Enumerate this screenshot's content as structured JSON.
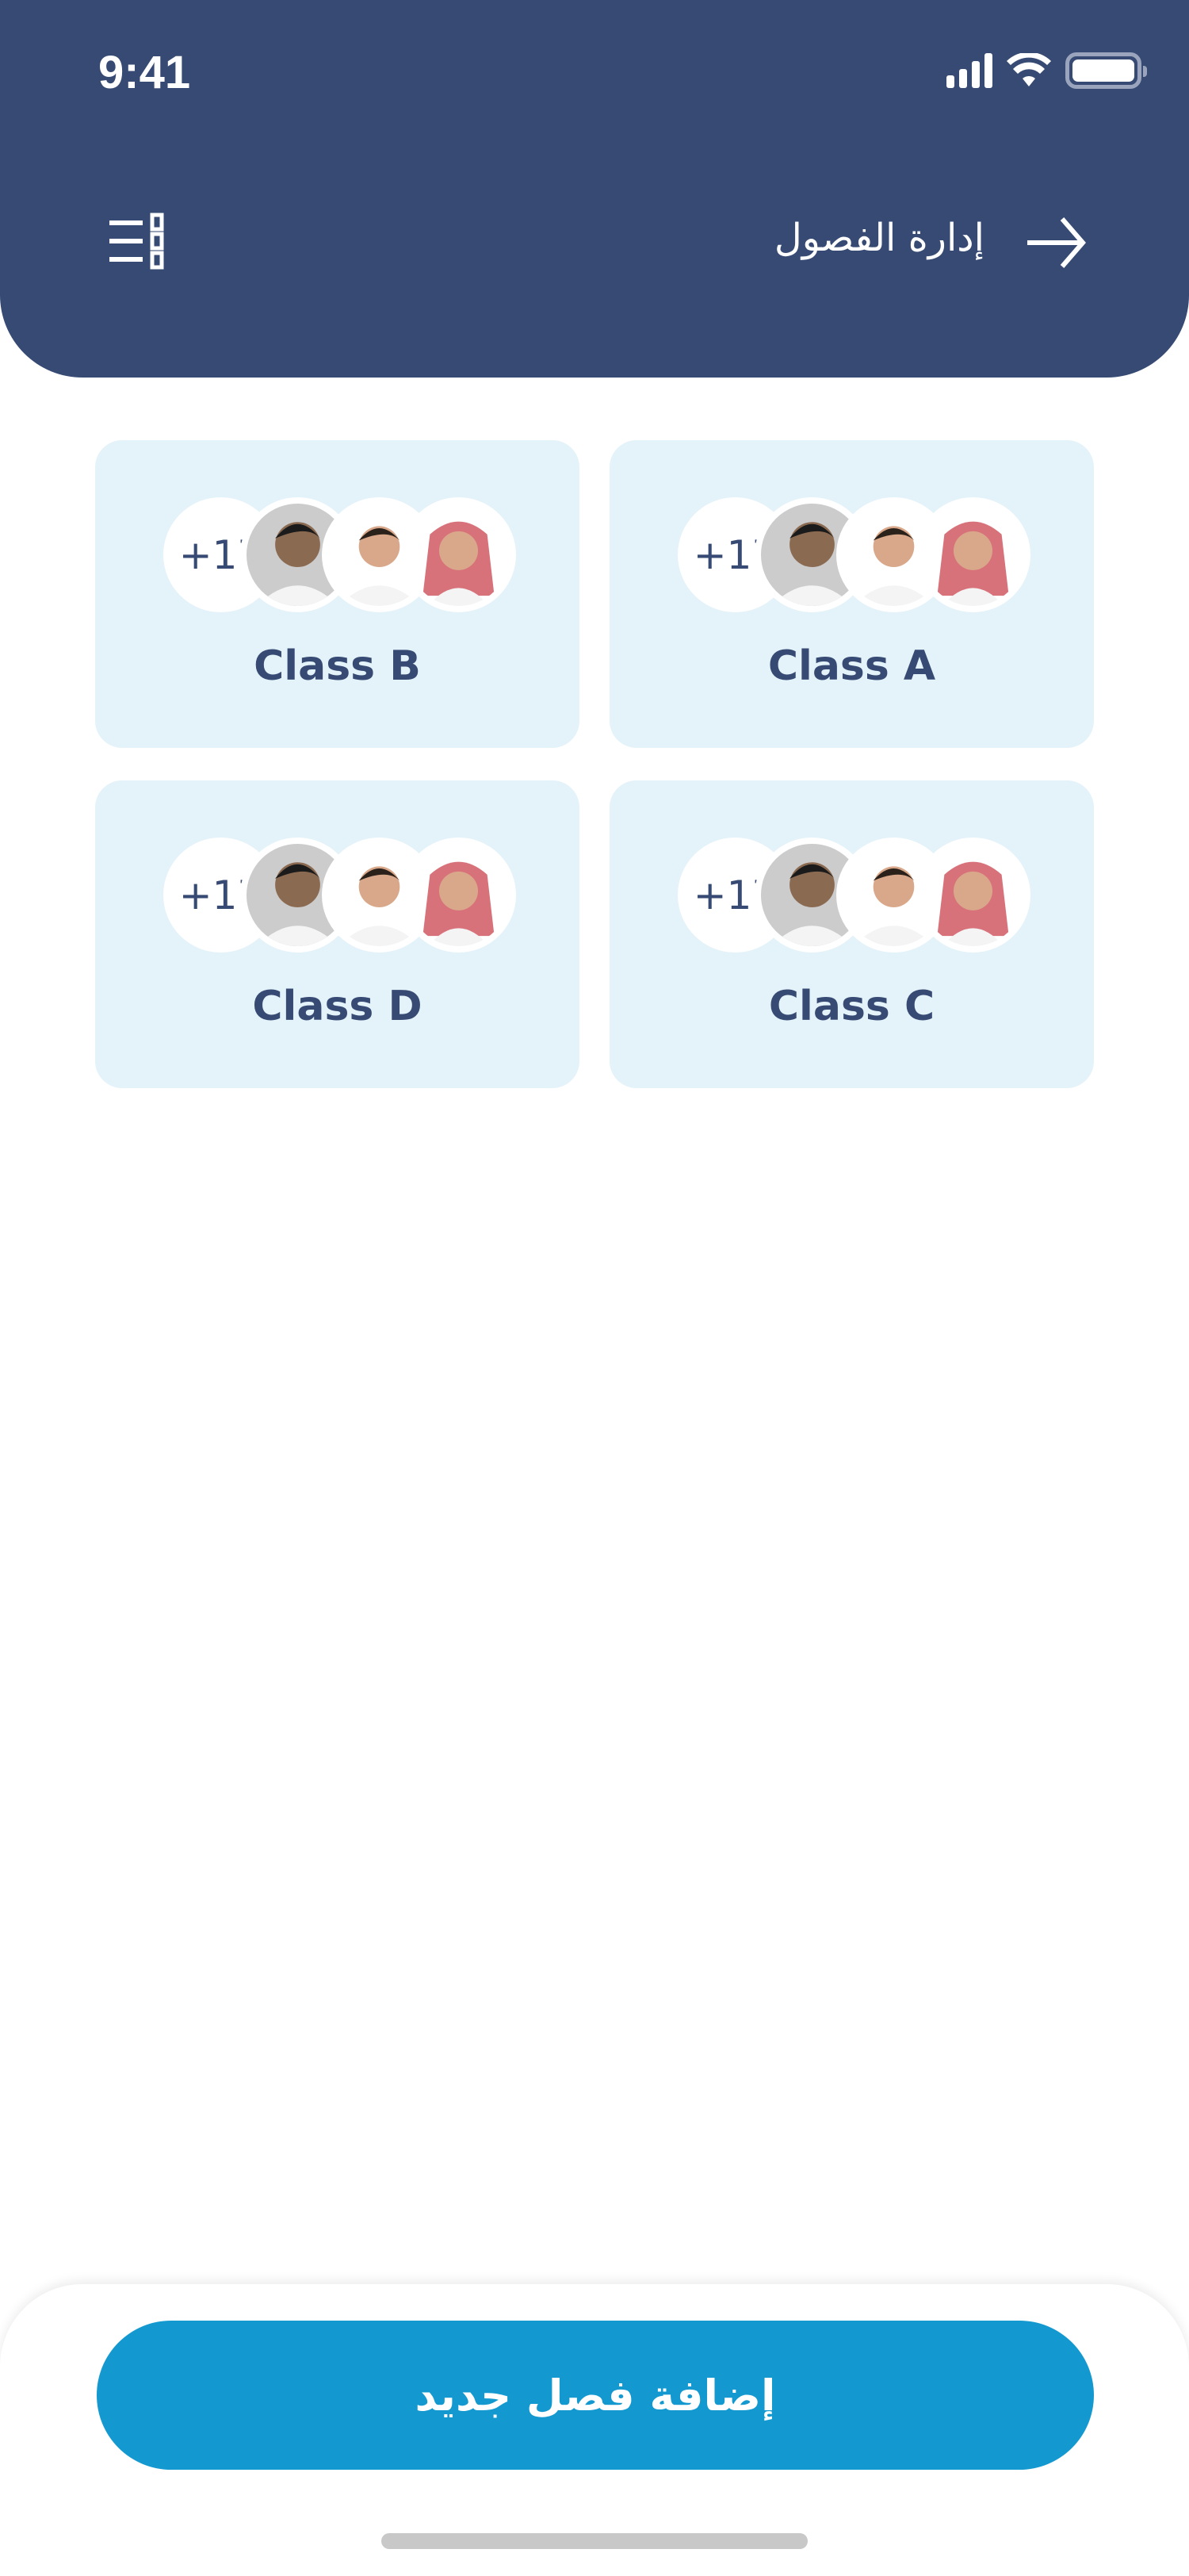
{
  "status_bar": {
    "time": "9:41"
  },
  "header": {
    "title": "إدارة الفصول",
    "back_icon": "arrow-right-icon",
    "menu_icon": "list-menu-icon"
  },
  "classes": [
    {
      "name": "Class A",
      "extra_count": "+17"
    },
    {
      "name": "Class B",
      "extra_count": "+17"
    },
    {
      "name": "Class C",
      "extra_count": "+17"
    },
    {
      "name": "Class D",
      "extra_count": "+17"
    }
  ],
  "footer": {
    "add_class_label": "إضافة فصل جديد"
  },
  "colors": {
    "primary": "#364A73",
    "accent": "#1399CF",
    "card_bg": "#E4F3F9"
  }
}
